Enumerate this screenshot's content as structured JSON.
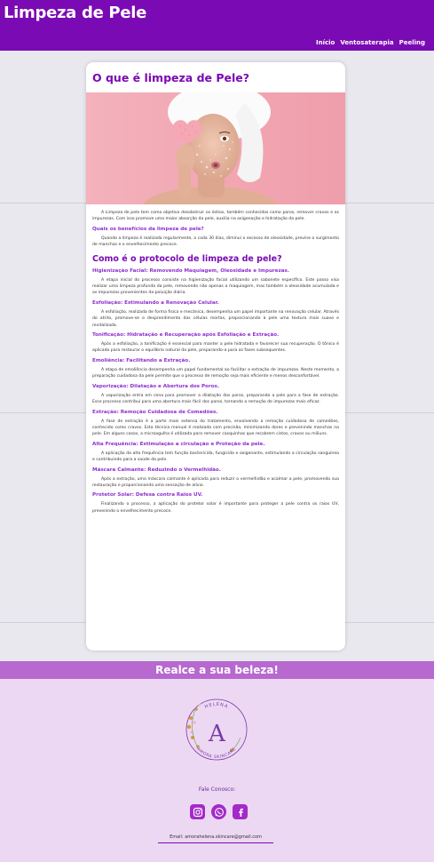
{
  "header": {
    "brand": "Limpeza de Pele",
    "nav": [
      "Início",
      "Ventosaterapia",
      "Peeling"
    ]
  },
  "article": {
    "title": "O que é limpeza de Pele?",
    "intro": "A Limpeza de pele tem como objetivo desobstruir os óstios, também conhecidos como poros, remover cravos e as impurezas. Com isso promove uma maior absorção da pele, auxilia na oxigenação e hidratação da pele.",
    "benefits_heading": "Quais os benefícios da limpeza de pele?",
    "benefits_text": "Quando a limpeza é realizada regularmente, a cada 30 dias, diminui o excesso de oleosidade, previne o surgimento de manchas e o envelhecimento precoce.",
    "protocol_heading": "Como é o protocolo de limpeza de pele?",
    "steps": [
      {
        "title": "Higienização Facial: Removendo Maquiagem, Oleosidade e Impurezas.",
        "text": "A etapa inicial do processo consiste na higienização facial utilizando um sabonete específico. Este passo visa realizar uma limpeza profunda da pele, removendo não apenas a maquiagem, mas também a oleosidade acumulada e as impurezas provenientes da poluição diária."
      },
      {
        "title": "Esfoliação: Estimulando a Renovação Celular.",
        "text": "A esfoliação, realizada de forma física e mecânica, desempenha um papel importante na renovação celular. Através do atrito, promove-se o desprendimento das células mortas, proporcionando à pele uma textura mais suave e revitalizada."
      },
      {
        "title": "Tonificação: Hidratação e Recuperação após Esfoliação e Extração.",
        "text": "Após a esfoliação, a tonificação é essencial para manter a pele hidratada e favorecer sua recuperação. O tônico é aplicado para restaurar o equilíbrio natural da pele, preparando-a para as fases subsequentes."
      },
      {
        "title": "Emoliência: Facilitando a Extração.",
        "text": "A etapa de emoliência desempenha um papel fundamental ao facilitar a extração de impurezas. Neste momento, a preparação cuidadosa da pele permite que o processo de remoção seja mais eficiente e menos desconfortável."
      },
      {
        "title": "Vaporização: Dilatação e Abertura dos Poros.",
        "text": "A vaporização entra em cena para promover a dilatação dos poros, preparando a pele para a fase de extração. Esse processo contribui para uma abertura mais fácil dos poros, tornando a remoção de impurezas mais eficaz."
      },
      {
        "title": "Extração: Remoção Cuidadosa de Comedões.",
        "text": "A fase de extração é a parte mais extensa do tratamento, envolvendo a remoção cuidadosa de comedões, conhecido como cravos. Esta técnica manual é realizada com precisão, minimizando dores e prevenindo manchas na pele. Em alguns casos, a microagulha é utilizada para remover casquinhas que recobrem cistos, cravos ou miliuns."
      },
      {
        "title": "Alta Frequência: Estimulação a circulação e Proteção da pele.",
        "text": "A aplicação da alta frequência tem função bactericida, fungicida e oxigenante, estimulando a circulação sanguínea e contribuindo para a saúde da pele."
      },
      {
        "title": "Máscara Calmante: Reduzindo o Vermelhidão.",
        "text": "Após a extração, uma máscara calmante é aplicada para reduzir o vermelhidão e acalmar a pele, promovendo sua restauração e proporcionando uma sensação de alívio."
      },
      {
        "title": "Protetor Solar: Defesa contra Raios UV.",
        "text": "Finalizando o processo, a aplicação do protetor solar é importante para proteger a pele contra os raios UV, prevenindo o envelhecimento precoce."
      }
    ]
  },
  "cta": {
    "text": "Realce a sua beleza!"
  },
  "footer": {
    "logo_text_top": "HELENA",
    "logo_text_bottom": "AMORA SKINCARE",
    "logo_letter": "A",
    "contact_label": "Fale Conosco:",
    "social_icons": [
      "instagram-icon",
      "whatsapp-icon",
      "facebook-icon"
    ],
    "email": "Email: amorahelena.skincare@gmail.com"
  },
  "colors": {
    "brand_purple": "#7a0ab3",
    "heading_purple": "#8f2fd0",
    "band_purple": "#b769cf",
    "footer_bg": "#ecd8f3"
  }
}
